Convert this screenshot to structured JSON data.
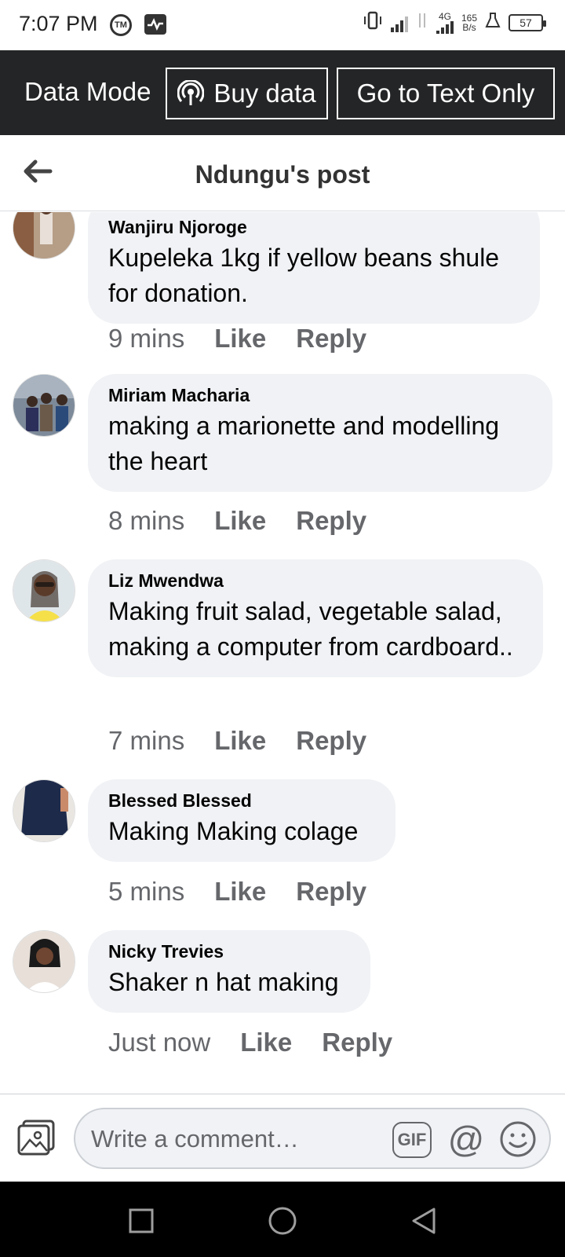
{
  "status_bar": {
    "time": "7:07 PM",
    "network": "4G",
    "speed_value": "165",
    "speed_unit": "B/s",
    "battery": "57"
  },
  "data_mode": {
    "label": "Data Mode",
    "buy_label": "Buy data",
    "text_only_label": "Go to Text Only"
  },
  "header": {
    "title": "Ndungu's post"
  },
  "comments": [
    {
      "name": "Wanjiru Njoroge",
      "text": "Kupeleka 1kg if yellow beans shule for donation.",
      "time": "9 mins",
      "like": "Like",
      "reply": "Reply"
    },
    {
      "name": "Miriam Macharia",
      "text": "making a marionette and  modelling the heart",
      "time": "8 mins",
      "like": "Like",
      "reply": "Reply"
    },
    {
      "name": "Liz Mwendwa",
      "text": "Making fruit salad, vegetable salad, making a computer from cardboard..",
      "time": "7 mins",
      "like": "Like",
      "reply": "Reply"
    },
    {
      "name": "Blessed Blessed",
      "text": "Making Making colage",
      "time": "5 mins",
      "like": "Like",
      "reply": "Reply"
    },
    {
      "name": "Nicky Trevies",
      "text": "Shaker n hat making",
      "time": "Just now",
      "like": "Like",
      "reply": "Reply"
    }
  ],
  "composer": {
    "placeholder": "Write a comment…",
    "gif_label": "GIF",
    "at_label": "@"
  },
  "icons": {
    "back": "arrow-left-icon",
    "buy_data": "wifi-broadcast-icon",
    "photo": "photo-icon",
    "emoji": "smiley-icon",
    "nav_recents": "square-icon",
    "nav_home": "circle-icon",
    "nav_back": "triangle-icon"
  },
  "colors": {
    "data_bar_bg": "#242526",
    "bubble_bg": "#f0f2f5",
    "meta_text": "#65676b"
  }
}
